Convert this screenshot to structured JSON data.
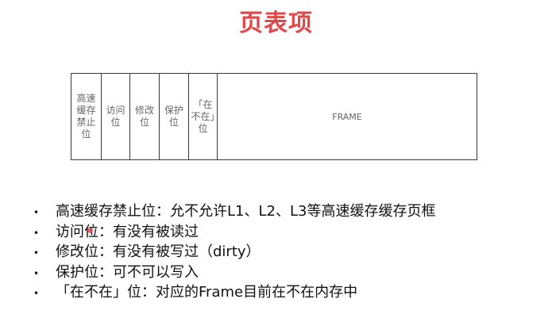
{
  "title": "页表项",
  "table": {
    "cells": [
      "高速缓存禁止位",
      "访问位",
      "修改位",
      "保护位",
      "「在不在」位",
      "FRAME"
    ]
  },
  "bullets": [
    "高速缓存禁止位：允不允许L1、L2、L3等高速缓存缓存页框",
    "访问位：有没有被读过",
    "修改位：有没有被写过（dirty）",
    "保护位：可不可以写入",
    "「在不在」位：对应的Frame目前在不在内存中"
  ],
  "colors": {
    "title": "#e0484a",
    "border": "#3a3a3a",
    "cell_text": "#666666"
  }
}
